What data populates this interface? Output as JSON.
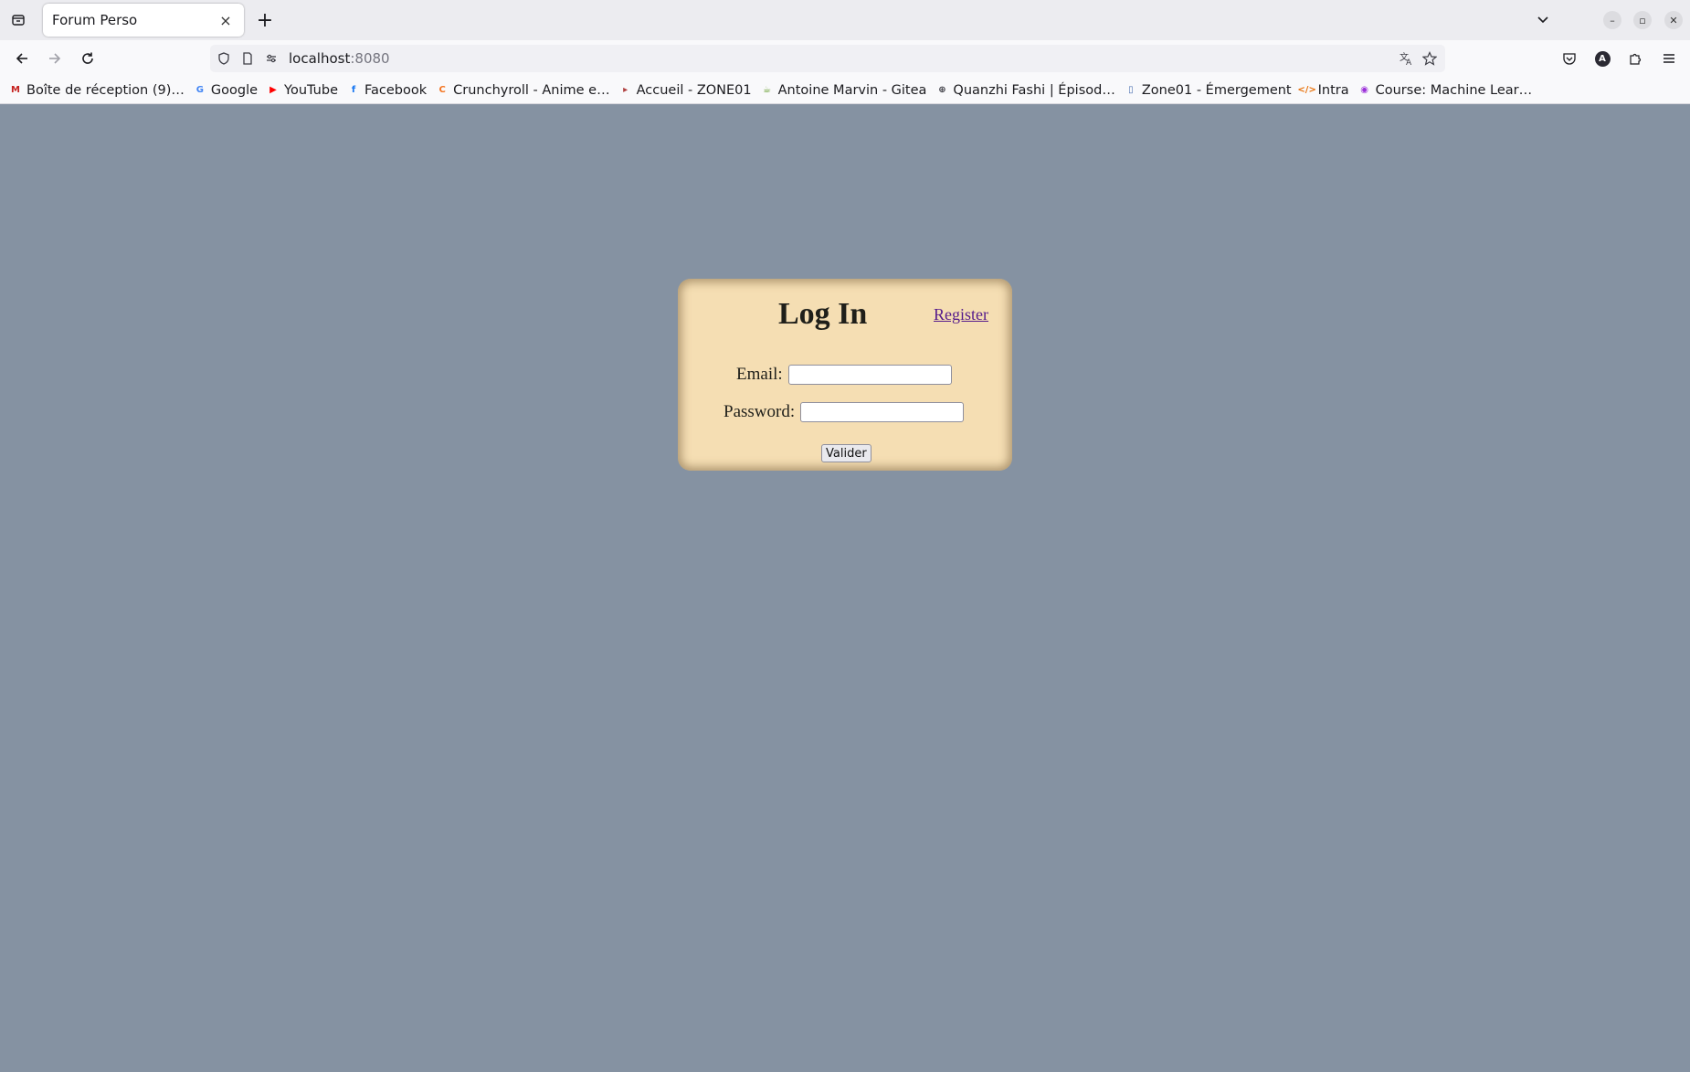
{
  "browser": {
    "tab": {
      "title": "Forum Perso",
      "close_symbol": "×"
    },
    "new_tab_symbol": "+",
    "url": {
      "host": "localhost",
      "port": ":8080"
    },
    "window_controls": {
      "minimize": "–",
      "restore": "▫",
      "close": "✕"
    },
    "profile_initial": "A",
    "bookmarks": [
      {
        "label": "Boîte de réception (9)…",
        "icon": "gmail-icon",
        "icon_text": "M",
        "color": "#c5221f"
      },
      {
        "label": "Google",
        "icon": "google-icon",
        "icon_text": "G",
        "color": "#4285f4"
      },
      {
        "label": "YouTube",
        "icon": "youtube-icon",
        "icon_text": "▶",
        "color": "#ff0000"
      },
      {
        "label": "Facebook",
        "icon": "facebook-icon",
        "icon_text": "f",
        "color": "#1877f2"
      },
      {
        "label": "Crunchyroll - Anime e…",
        "icon": "crunchyroll-icon",
        "icon_text": "C",
        "color": "#f47521"
      },
      {
        "label": "Accueil - ZONE01",
        "icon": "zone01-icon",
        "icon_text": "▸",
        "color": "#b04040"
      },
      {
        "label": "Antoine Marvin - Gitea",
        "icon": "gitea-icon",
        "icon_text": "☕",
        "color": "#609926"
      },
      {
        "label": "Quanzhi Fashi | Épisod…",
        "icon": "globe-icon",
        "icon_text": "⊕",
        "color": "#3d3d45"
      },
      {
        "label": "Zone01 - Émergement",
        "icon": "zone01-doc-icon",
        "icon_text": "▯",
        "color": "#4a6fb0"
      },
      {
        "label": "Intra",
        "icon": "code-icon",
        "icon_text": "</>",
        "color": "#e8710a"
      },
      {
        "label": "Course: Machine Lear…",
        "icon": "course-icon",
        "icon_text": "◉",
        "color": "#9b30d9"
      }
    ]
  },
  "login": {
    "title": "Log In",
    "register_link": "Register",
    "email_label": "Email:",
    "email_value": "",
    "password_label": "Password:",
    "password_value": "",
    "submit_label": "Valider"
  }
}
